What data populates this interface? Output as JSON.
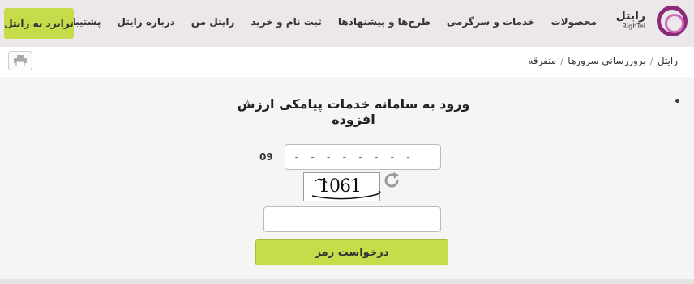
{
  "header": {
    "brand_fa": "رایتل",
    "brand_en": "RighTel",
    "nav": [
      "محصولات",
      "خدمات و سرگرمی",
      "طرح‌ها و پیشنهادها",
      "ثبت نام و خرید",
      "رایتل من",
      "درباره رایتل",
      "پشتیبانی"
    ],
    "cta_label": "ترابرد به رایتل",
    "colors": {
      "header_bg": "#ebe7ea",
      "accent": "#c7dc4b",
      "brand": "#8a2a78"
    }
  },
  "breadcrumb": [
    "رایتل",
    "بروزرسانی سرورها",
    "متفرقه"
  ],
  "toolbar": {
    "print_icon": "printer-icon"
  },
  "main": {
    "title": "ورود به سامانه خدمات پیامکی ارزش افزوده",
    "phone_prefix": "09",
    "phone_placeholder": "- - - - - - - -",
    "captcha_text": "1061",
    "refresh_icon": "refresh-icon",
    "code_value": "",
    "submit_label": "درخواست رمز"
  }
}
